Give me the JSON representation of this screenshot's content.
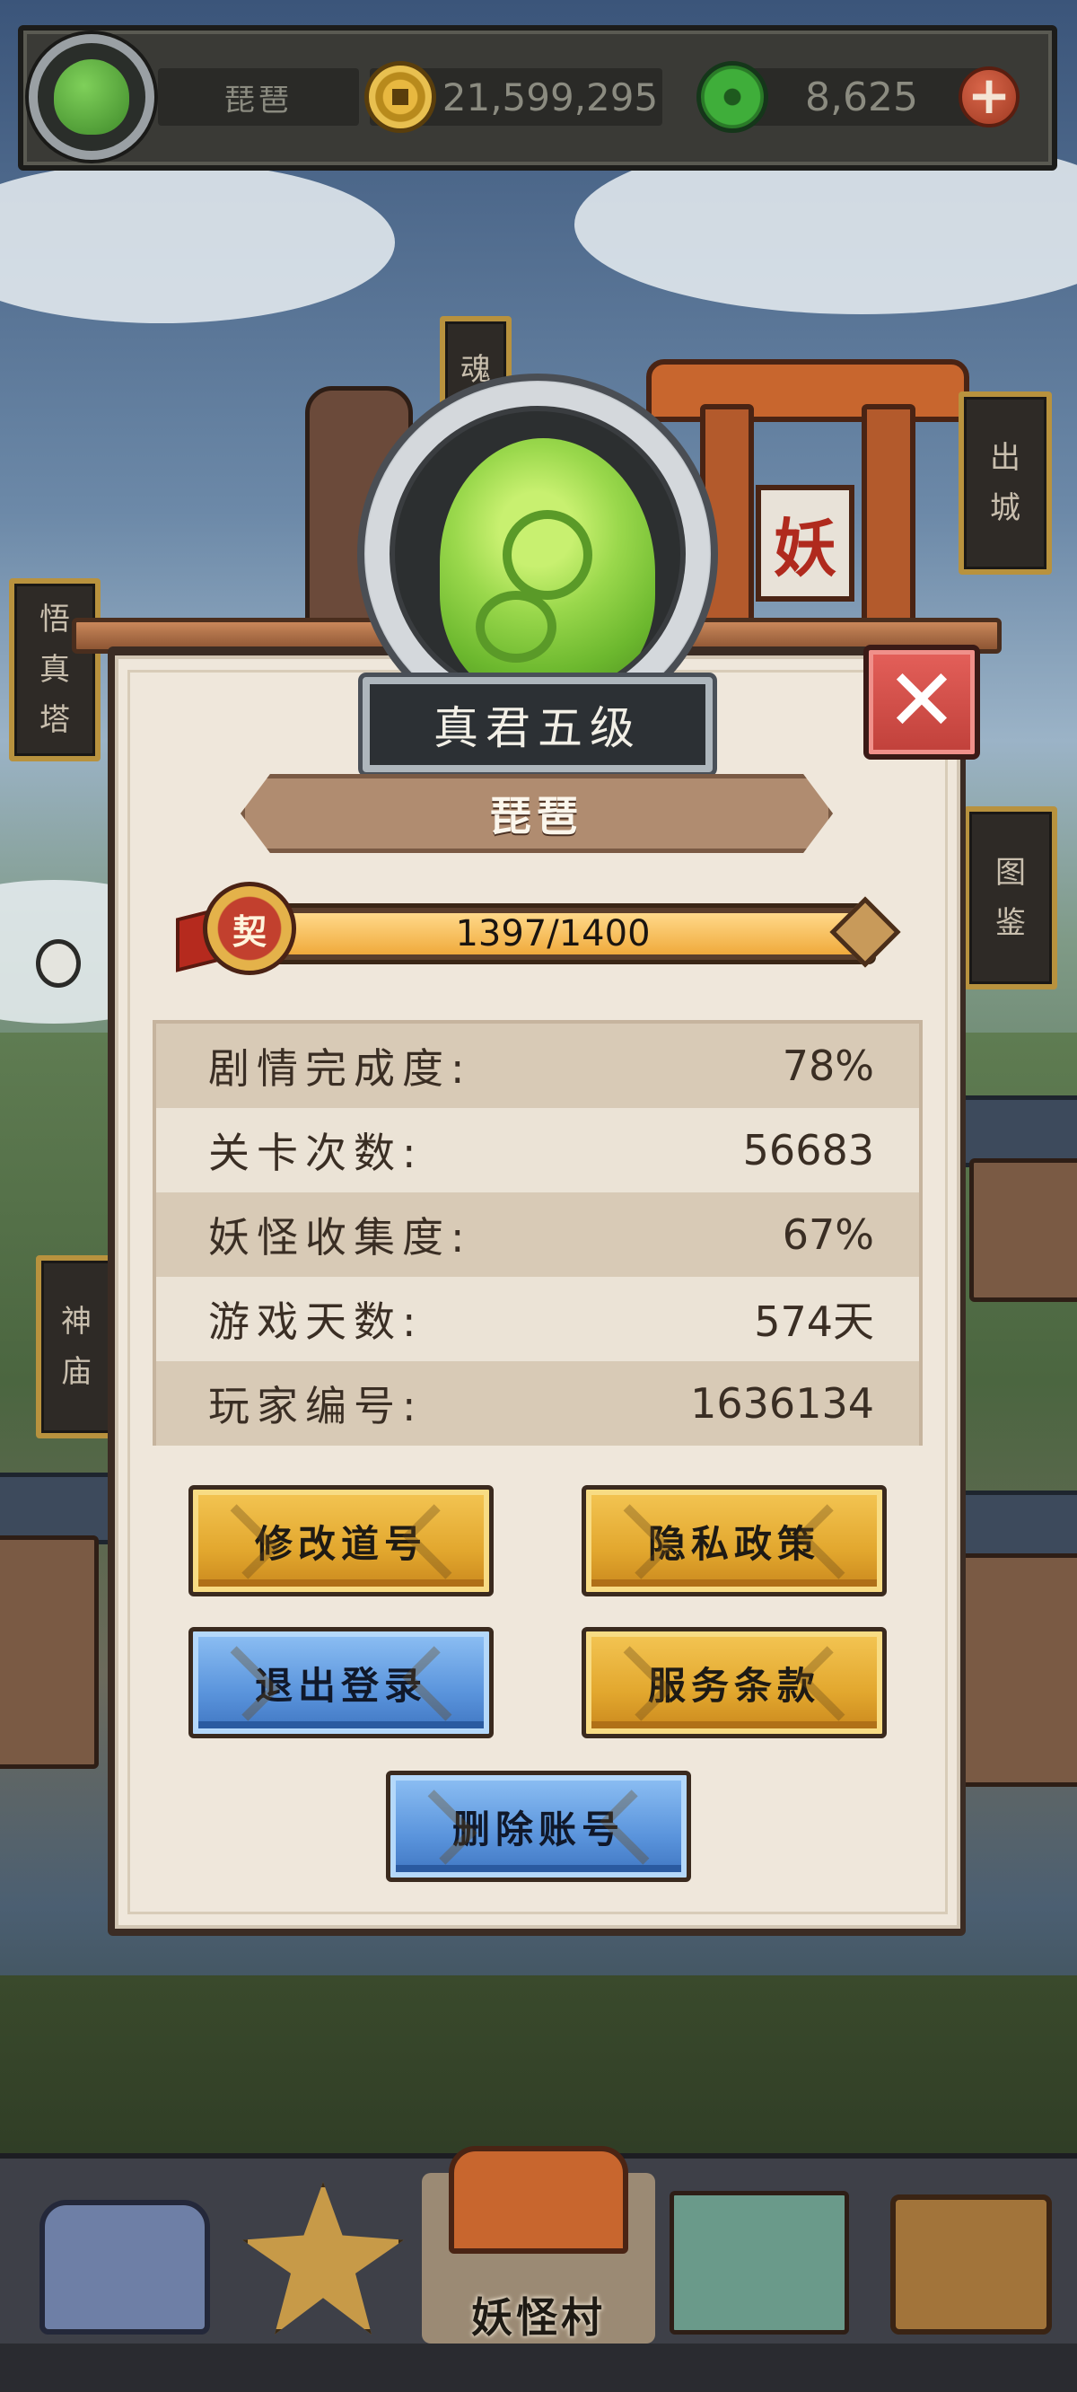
{
  "player": {
    "name_top": "琵琶",
    "coins": "21,599,295",
    "jade": "8,625"
  },
  "signs": {
    "left_top": [
      "悟",
      "真",
      "塔"
    ],
    "left_bottom": [
      "神",
      "庙"
    ],
    "right_top": [
      "出",
      "城"
    ],
    "right_mid": [
      "图",
      "鉴"
    ],
    "center_top": "魂",
    "torii_plaque": "妖"
  },
  "profile": {
    "rank_title": "真君五级",
    "name": "琵琶",
    "contract_badge": "契",
    "xp_text": "1397/1400",
    "xp_fraction": 0.998
  },
  "stats": [
    {
      "label": "剧情完成度:",
      "value": "78%"
    },
    {
      "label": "关卡次数:",
      "value": "56683"
    },
    {
      "label": "妖怪收集度:",
      "value": "67%"
    },
    {
      "label": "游戏天数:",
      "value": "574天"
    },
    {
      "label": "玩家编号:",
      "value": "1636134"
    }
  ],
  "buttons": {
    "rename": "修改道号",
    "privacy": "隐私政策",
    "logout": "退出登录",
    "terms": "服务条款",
    "delete_account": "删除账号"
  },
  "close_symbol": "✕",
  "nav": {
    "active_label": "妖怪村"
  },
  "colors": {
    "button_gold": "#e2a72e",
    "button_blue": "#5a94dc",
    "close_red": "#d04a44",
    "panel": "#efe7db"
  }
}
